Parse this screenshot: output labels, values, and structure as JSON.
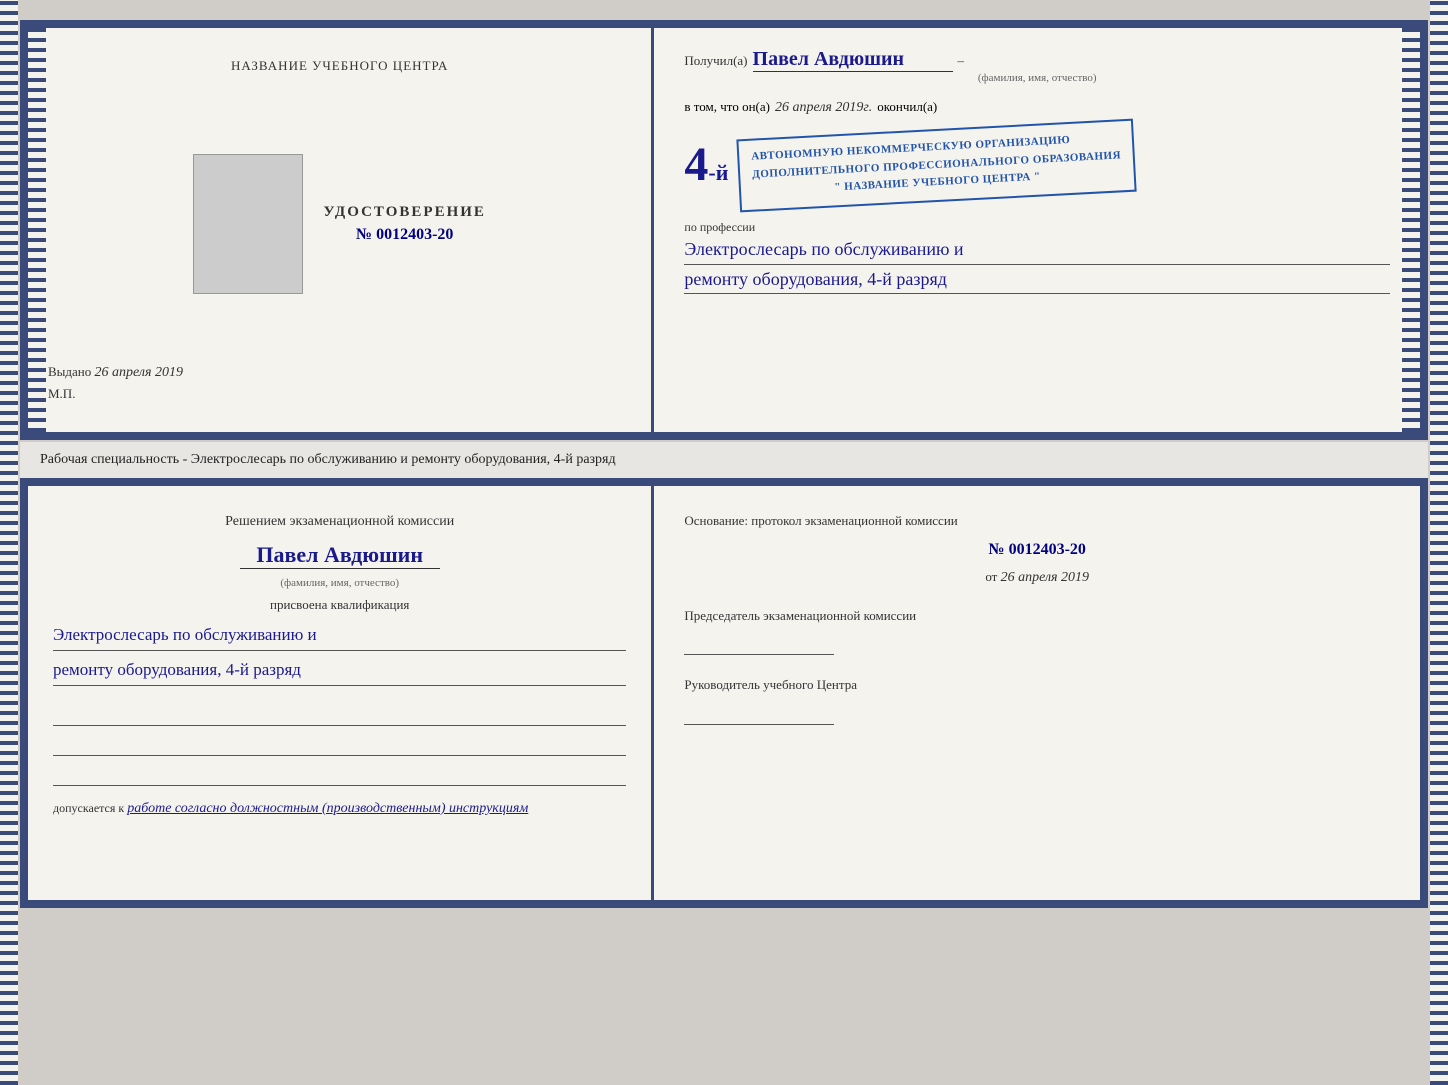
{
  "top_cert": {
    "left": {
      "training_center_label": "НАЗВАНИЕ УЧЕБНОГО ЦЕНТРА",
      "cert_title": "УДОСТОВЕРЕНИЕ",
      "cert_number": "№ 0012403-20",
      "issued_label": "Выдано",
      "issued_date": "26 апреля 2019",
      "mp_label": "М.П."
    },
    "right": {
      "received_label": "Получил(а)",
      "person_name": "Павел Авдюшин",
      "fio_hint": "(фамилия, имя, отчество)",
      "vtom_label": "в том, что он(а)",
      "date_value": "26 апреля 2019г.",
      "okonchil_label": "окончил(а)",
      "grade_text": "4-й",
      "org_line1": "АВТОНОМНУЮ НЕКОММЕРЧЕСКУЮ ОРГАНИЗАЦИЮ",
      "org_line2": "ДОПОЛНИТЕЛЬНОГО ПРОФЕССИОНАЛЬНОГО ОБРАЗОВАНИЯ",
      "org_name": "\" НАЗВАНИЕ УЧЕБНОГО ЦЕНТРА \"",
      "profession_label": "по профессии",
      "profession_text1": "Электрослесарь по обслуживанию и",
      "profession_text2": "ремонту оборудования, 4-й разряд"
    }
  },
  "middle_text": "Рабочая специальность - Электрослесарь по обслуживанию и ремонту оборудования, 4-й разряд",
  "bottom_cert": {
    "left": {
      "komissia_title": "Решением экзаменационной комиссии",
      "person_name": "Павел Авдюшин",
      "fio_hint": "(фамилия, имя, отчество)",
      "prisvoyena_label": "присвоена квалификация",
      "qualification_text1": "Электрослесарь по обслуживанию и",
      "qualification_text2": "ремонту оборудования, 4-й разряд",
      "dopuskaetsya_label": "допускается к",
      "dopuskaetsya_value": "работе согласно должностным (производственным) инструкциям"
    },
    "right": {
      "osnovaniye_label": "Основание: протокол экзаменационной комиссии",
      "protocol_number": "№ 0012403-20",
      "ot_label": "от",
      "ot_date": "26 апреля 2019",
      "predsedatel_label": "Председатель экзаменационной комиссии",
      "rukovoditel_label": "Руководитель учебного Центра"
    }
  }
}
